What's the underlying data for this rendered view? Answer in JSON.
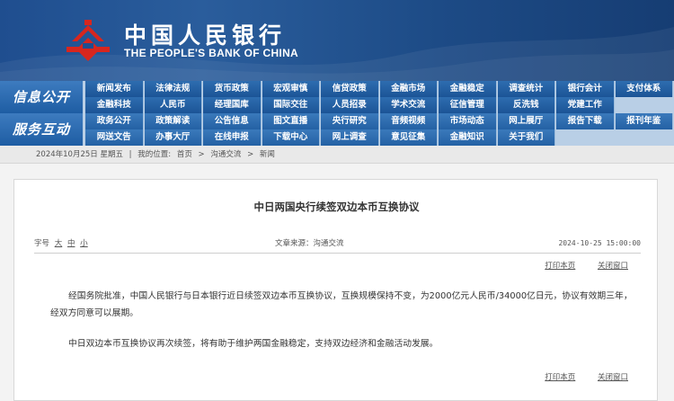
{
  "header": {
    "brand_cn": "中国人民银行",
    "brand_en": "THE PEOPLE'S BANK OF CHINA",
    "logo_icon": "pboc-logo-icon"
  },
  "nav": {
    "group1_label": "信息公开",
    "group2_label": "服务互动",
    "row1": [
      "新闻发布",
      "法律法规",
      "货币政策",
      "宏观审慎",
      "信贷政策",
      "金融市场",
      "金融稳定",
      "调查统计",
      "银行会计",
      "支付体系",
      "金融科技",
      "人民币",
      "经理国库",
      "国际交往",
      "人员招录",
      "学术交流",
      "征信管理",
      "反洗钱",
      "党建工作"
    ],
    "row2": [
      "政务公开",
      "政策解读",
      "公告信息",
      "图文直播",
      "央行研究",
      "音频视频",
      "市场动态",
      "网上展厅",
      "报告下载",
      "报刊年鉴",
      "网送文告",
      "办事大厅",
      "在线申报",
      "下载中心",
      "网上调查",
      "意见征集",
      "金融知识",
      "关于我们"
    ]
  },
  "breadcrumb": {
    "date": "2024年10月25日 星期五",
    "sep": "|",
    "location_label": "我的位置:",
    "home": "首页",
    "arrow": ">",
    "section": "沟通交流",
    "arrow2": ">",
    "page": "新闻"
  },
  "article": {
    "title": "中日两国央行续签双边本币互换协议",
    "font_size_label": "字号",
    "font_sizes": [
      "大",
      "中",
      "小"
    ],
    "source": "文章来源：沟通交流",
    "datetime": "2024-10-25 15:00:00",
    "print": "打印本页",
    "close": "关闭窗口",
    "paragraph1": "经国务院批准，中国人民银行与日本银行近日续签双边本币互换协议，互换规模保持不变，为2000亿元人民币/34000亿日元，协议有效期三年，经双方同意可以展期。",
    "paragraph2": "中日双边本币互换协议再次续签，将有助于维护两国金融稳定，支持双边经济和金融活动发展。"
  }
}
